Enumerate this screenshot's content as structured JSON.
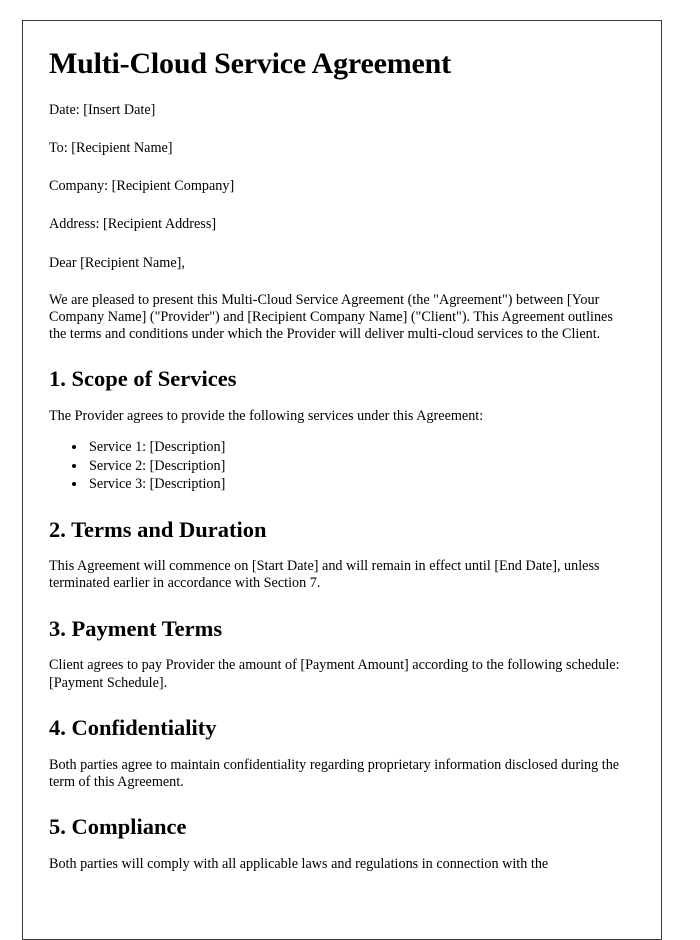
{
  "document": {
    "title": "Multi-Cloud Service Agreement",
    "meta": {
      "date_line": "Date: [Insert Date]",
      "to_line": "To: [Recipient Name]",
      "company_line": "Company: [Recipient Company]",
      "address_line": "Address: [Recipient Address]"
    },
    "salutation": "Dear [Recipient Name],",
    "intro_paragraph": "We are pleased to present this Multi-Cloud Service Agreement (the \"Agreement\") between [Your Company Name] (\"Provider\") and [Recipient Company Name] (\"Client\"). This Agreement outlines the terms and conditions under which the Provider will deliver multi-cloud services to the Client.",
    "sections": [
      {
        "heading": "1. Scope of Services",
        "paragraph": "The Provider agrees to provide the following services under this Agreement:",
        "list": [
          "Service 1: [Description]",
          "Service 2: [Description]",
          "Service 3: [Description]"
        ]
      },
      {
        "heading": "2. Terms and Duration",
        "paragraph": "This Agreement will commence on [Start Date] and will remain in effect until [End Date], unless terminated earlier in accordance with Section 7."
      },
      {
        "heading": "3. Payment Terms",
        "paragraph": "Client agrees to pay Provider the amount of [Payment Amount] according to the following schedule: [Payment Schedule]."
      },
      {
        "heading": "4. Confidentiality",
        "paragraph": "Both parties agree to maintain confidentiality regarding proprietary information disclosed during the term of this Agreement."
      },
      {
        "heading": "5. Compliance",
        "paragraph": "Both parties will comply with all applicable laws and regulations in connection with the"
      }
    ]
  }
}
